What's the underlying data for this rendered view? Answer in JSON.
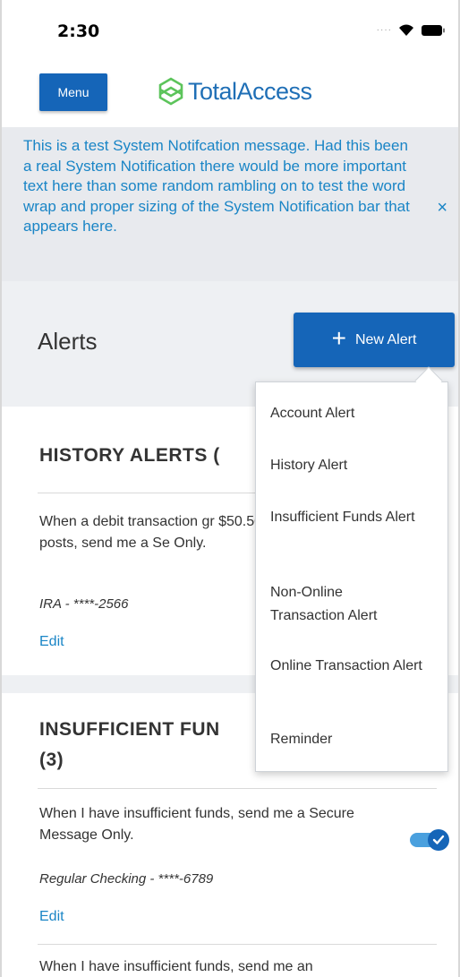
{
  "status_bar": {
    "time": "2:30"
  },
  "header": {
    "menu_label": "Menu",
    "logo_text": "TotalAccess"
  },
  "notification": {
    "message": "This is a test System Notifcation message. Had this been a real System Notification there would be more important text here than some random rambling on to test the word wrap and proper sizing of the System Notification bar that appears here.",
    "close_glyph": "×"
  },
  "alerts": {
    "title": "Alerts",
    "new_alert_label": "New Alert",
    "plus_glyph": "+"
  },
  "history_section": {
    "title": "HISTORY ALERTS (",
    "rule": "When a debit transaction gr $50.50 posts, send me a Se Only.",
    "account": "IRA - ****-2566",
    "edit_label": "Edit"
  },
  "insufficient_section": {
    "title_line1": "INSUFFICIENT FUN",
    "title_line2": "(3)",
    "rule": "When I have insufficient funds, send me a Secure Message Only.",
    "account": "Regular Checking - ****-6789",
    "edit_label": "Edit",
    "toggle_on": true,
    "next_rule": "When I have insufficient funds, send me an"
  },
  "dropdown": {
    "items": [
      "Account Alert",
      "History Alert",
      "Insufficient Funds Alert",
      "Non-Online Transaction Alert",
      "Online Transaction Alert",
      "Reminder"
    ]
  },
  "colors": {
    "primary": "#1565b8",
    "link": "#1a85c6",
    "logo_green": "#5cc45b",
    "band": "#eef0f3"
  }
}
